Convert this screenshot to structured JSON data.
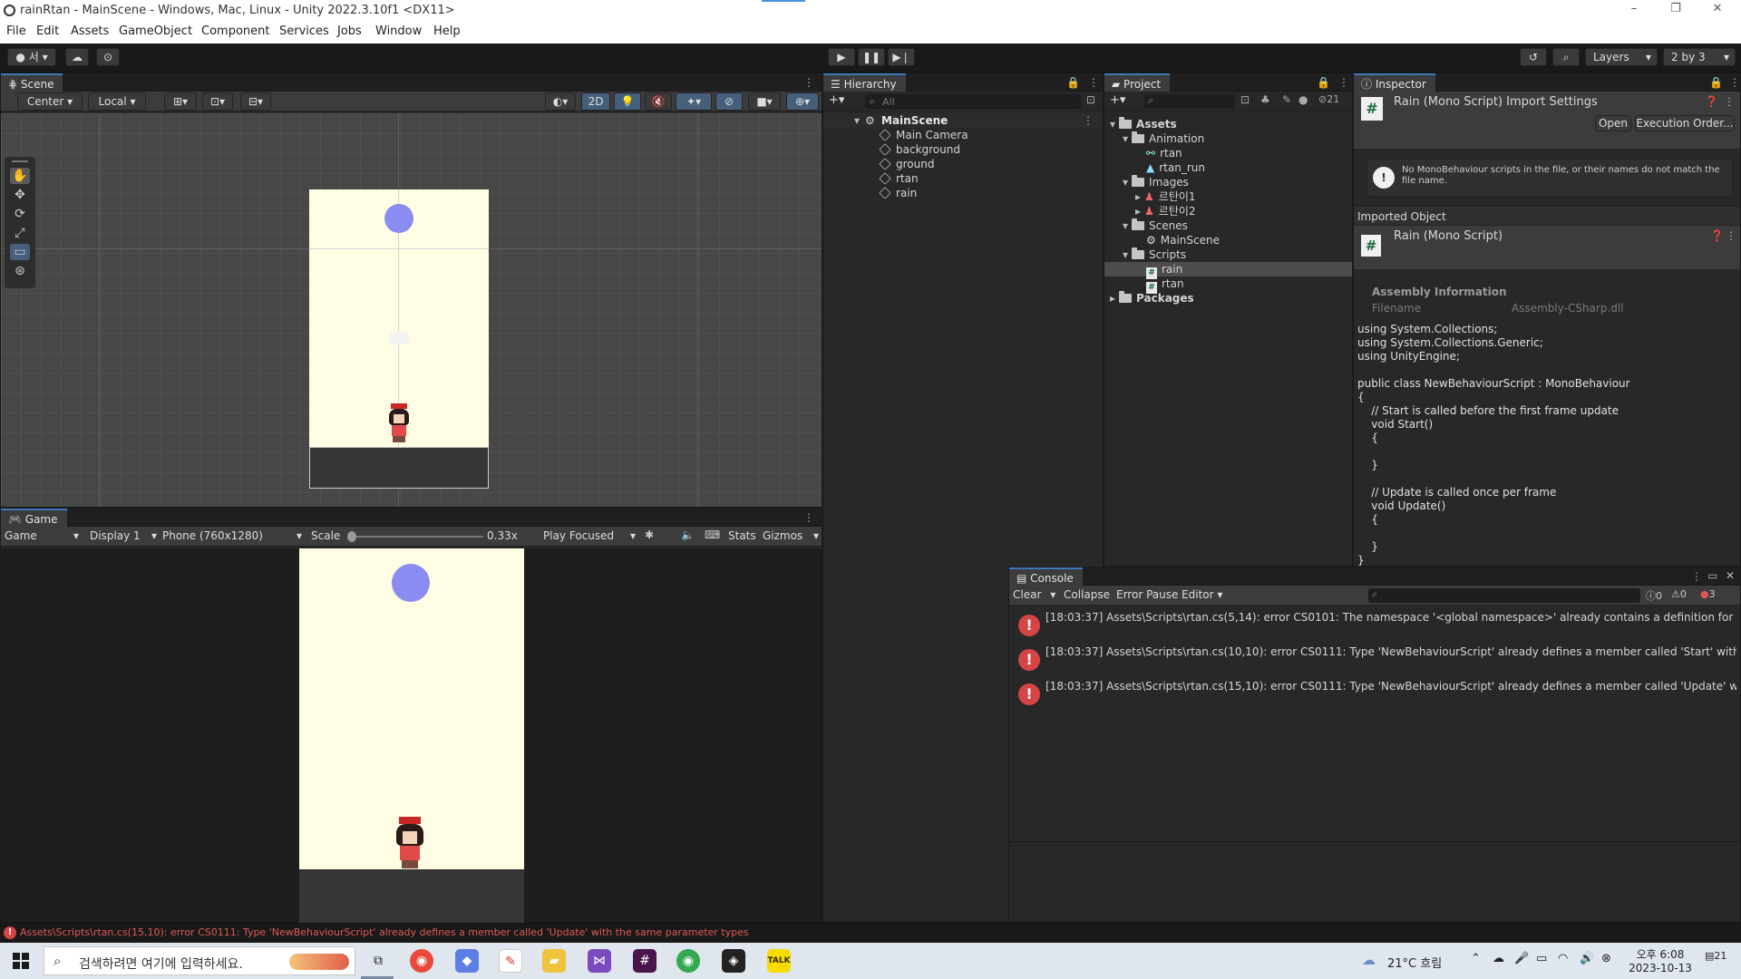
{
  "window": {
    "title": "rainRtan - MainScene - Windows, Mac, Linux - Unity 2022.3.10f1 <DX11>",
    "minimize": "–",
    "maximize": "❐",
    "close": "✕"
  },
  "menu": [
    "File",
    "Edit",
    "Assets",
    "GameObject",
    "Component",
    "Services",
    "Jobs",
    "Window",
    "Help"
  ],
  "toolbar": {
    "account_label": "서",
    "layers_label": "Layers",
    "layout_label": "2 by 3"
  },
  "scene": {
    "tab": "Scene",
    "pivot": "Center",
    "space": "Local",
    "mode_2d": "2D"
  },
  "game": {
    "tab": "Game",
    "view_select": "Game",
    "display": "Display 1",
    "resolution": "Phone (760x1280)",
    "scale_label": "Scale",
    "scale_value": "0.33x",
    "play_mode": "Play Focused",
    "stats": "Stats",
    "gizmos": "Gizmos"
  },
  "hierarchy": {
    "tab": "Hierarchy",
    "search_placeholder": "All",
    "scene_name": "MainScene",
    "items": [
      "Main Camera",
      "background",
      "ground",
      "rtan",
      "rain"
    ]
  },
  "project": {
    "tab": "Project",
    "hidden_count": "21",
    "tree": {
      "assets": "Assets",
      "animation": "Animation",
      "anim_items": [
        "rtan",
        "rtan_run"
      ],
      "images": "Images",
      "image_items": [
        "르탄이1",
        "르탄이2"
      ],
      "scenes": "Scenes",
      "scene_items": [
        "MainScene"
      ],
      "scripts": "Scripts",
      "script_items": [
        "rain",
        "rtan"
      ],
      "packages": "Packages"
    }
  },
  "inspector": {
    "tab": "Inspector",
    "header_title": "Rain (Mono Script) Import Settings",
    "open_button": "Open",
    "execution_order_button": "Execution Order...",
    "warning": "No MonoBehaviour scripts in the file, or their names do not match the file name.",
    "imported_object_label": "Imported Object",
    "imported_title": "Rain (Mono Script)",
    "assembly_info": "Assembly Information",
    "filename_label": "Filename",
    "filename_value": "Assembly-CSharp.dll",
    "code": [
      "using System.Collections;",
      "using System.Collections.Generic;",
      "using UnityEngine;",
      "",
      "public class NewBehaviourScript : MonoBehaviour",
      "{",
      "    // Start is called before the first frame update",
      "    void Start()",
      "    {",
      "",
      "    }",
      "",
      "    // Update is called once per frame",
      "    void Update()",
      "    {",
      "",
      "    }",
      "}"
    ]
  },
  "console": {
    "tab": "Console",
    "clear": "Clear",
    "collapse": "Collapse",
    "error_pause": "Error Pause",
    "editor": "Editor",
    "count_log": "0",
    "count_warn": "0",
    "count_err": "3",
    "messages": [
      "[18:03:37] Assets\\Scripts\\rtan.cs(5,14): error CS0101: The namespace '<global namespace>' already contains a definition for 'NewBehaviourScript'",
      "[18:03:37] Assets\\Scripts\\rtan.cs(10,10): error CS0111: Type 'NewBehaviourScript' already defines a member called 'Start' with the same parameter types",
      "[18:03:37] Assets\\Scripts\\rtan.cs(15,10): error CS0111: Type 'NewBehaviourScript' already defines a member called 'Update' with the same parameter types"
    ]
  },
  "status": {
    "message": "Assets\\Scripts\\rtan.cs(15,10): error CS0111: Type 'NewBehaviourScript' already defines a member called 'Update' with the same parameter types"
  },
  "taskbar": {
    "search_placeholder": "검색하려면 여기에 입력하세요.",
    "weather": "21°C  흐림",
    "time": "오후 6:08",
    "date": "2023-10-13",
    "notifications": "21"
  },
  "colors": {
    "accent": "#3a79bb",
    "error": "#d64545",
    "canvas": "#fffde3",
    "rain_drop": "#8b8cf2",
    "ground": "#363636"
  }
}
